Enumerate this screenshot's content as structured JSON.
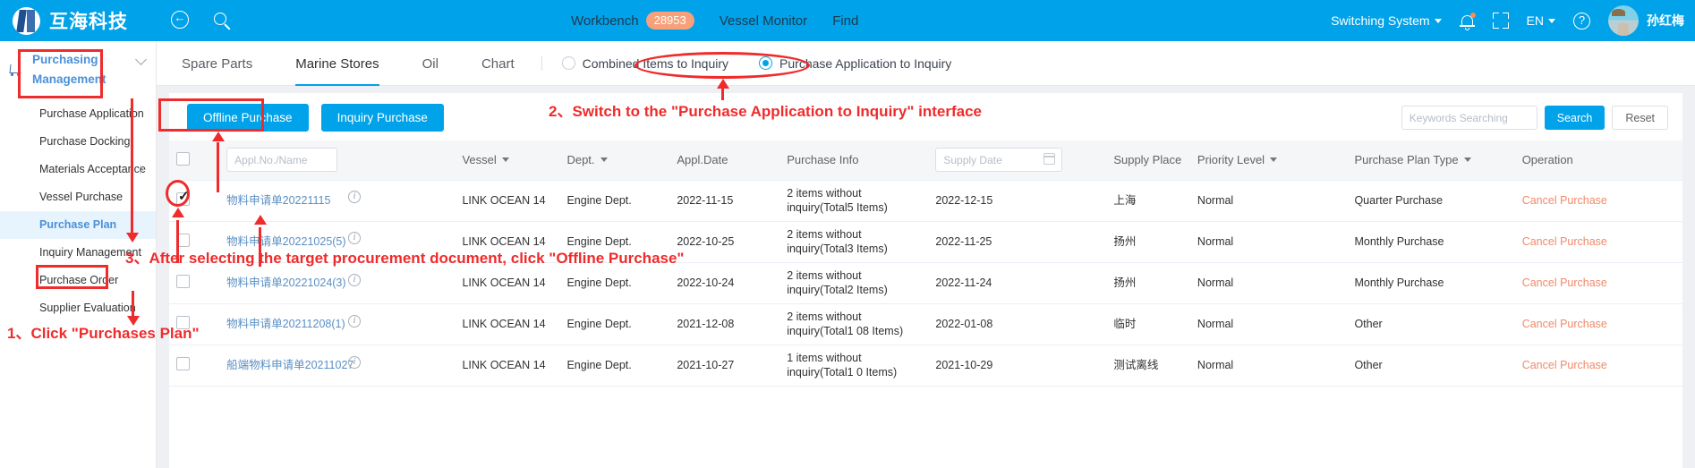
{
  "header": {
    "brand": "互海科技",
    "back_icon": "back-circle-icon",
    "search_icon": "search-icon",
    "workbench_label": "Workbench",
    "workbench_count": "28953",
    "vessel_monitor_label": "Vessel Monitor",
    "find_label": "Find",
    "switching_system_label": "Switching System",
    "bell_icon": "notification-bell-icon",
    "fullscreen_icon": "fullscreen-icon",
    "language_label": "EN",
    "help_icon": "help-circle-icon",
    "user_name": "孙红梅"
  },
  "sidebar": {
    "section_title": "Purchasing Management",
    "items": [
      {
        "label": "Purchase Application",
        "active": false,
        "has_sub": false
      },
      {
        "label": "Purchase Docking",
        "active": false,
        "has_sub": false
      },
      {
        "label": "Materials Acceptance",
        "active": false,
        "has_sub": true
      },
      {
        "label": "Vessel Purchase",
        "active": false,
        "has_sub": false
      },
      {
        "label": "Purchase Plan",
        "active": true,
        "has_sub": false
      },
      {
        "label": "Inquiry Management",
        "active": false,
        "has_sub": false
      },
      {
        "label": "Purchase Order",
        "active": false,
        "has_sub": false
      },
      {
        "label": "Supplier Evaluation",
        "active": false,
        "has_sub": false
      }
    ]
  },
  "tabs": [
    {
      "label": "Spare Parts",
      "active": false
    },
    {
      "label": "Marine Stores",
      "active": true
    },
    {
      "label": "Oil",
      "active": false
    },
    {
      "label": "Chart",
      "active": false
    }
  ],
  "radios": [
    {
      "label": "Combined Items to Inquiry",
      "checked": false
    },
    {
      "label": "Purchase Application to Inquiry",
      "checked": true
    }
  ],
  "toolbar": {
    "offline_purchase_label": "Offline Purchase",
    "inquiry_purchase_label": "Inquiry Purchase",
    "keywords_placeholder": "Keywords Searching",
    "keywords_value": "",
    "search_label": "Search",
    "reset_label": "Reset"
  },
  "table": {
    "columns": [
      {
        "key": "checkbox",
        "label": ""
      },
      {
        "key": "appl_no",
        "label": "Appl.No./Name",
        "type": "input",
        "placeholder": "Appl.No./Name"
      },
      {
        "key": "vessel",
        "label": "Vessel",
        "sortable": true
      },
      {
        "key": "dept",
        "label": "Dept.",
        "sortable": true
      },
      {
        "key": "appl_date",
        "label": "Appl.Date"
      },
      {
        "key": "purchase_info",
        "label": "Purchase Info"
      },
      {
        "key": "supply_date",
        "label": "Supply Date",
        "type": "date",
        "placeholder": "Supply Date"
      },
      {
        "key": "supply_place",
        "label": "Supply Place"
      },
      {
        "key": "priority",
        "label": "Priority Level",
        "sortable": true
      },
      {
        "key": "plan_type",
        "label": "Purchase Plan Type",
        "sortable": true
      },
      {
        "key": "operation",
        "label": "Operation"
      }
    ],
    "header_all_checked": false,
    "rows": [
      {
        "checked": true,
        "appl_no": "物料申请单20221115",
        "info_icon": "info-circle-icon",
        "vessel": "LINK OCEAN 14",
        "dept": "Engine Dept.",
        "appl_date": "2022-11-15",
        "purchase_info": "2 items without inquiry(Total5 Items)",
        "supply_date": "2022-12-15",
        "supply_place": "上海",
        "priority": "Normal",
        "plan_type": "Quarter Purchase",
        "operation": "Cancel Purchase"
      },
      {
        "checked": false,
        "appl_no": "物料申请单20221025(5)",
        "info_icon": "info-circle-icon",
        "vessel": "LINK OCEAN 14",
        "dept": "Engine Dept.",
        "appl_date": "2022-10-25",
        "purchase_info": "2 items without inquiry(Total3 Items)",
        "supply_date": "2022-11-25",
        "supply_place": "扬州",
        "priority": "Normal",
        "plan_type": "Monthly Purchase",
        "operation": "Cancel Purchase"
      },
      {
        "checked": false,
        "appl_no": "物料申请单20221024(3)",
        "info_icon": "info-circle-icon",
        "vessel": "LINK OCEAN 14",
        "dept": "Engine Dept.",
        "appl_date": "2022-10-24",
        "purchase_info": "2 items without inquiry(Total2 Items)",
        "supply_date": "2022-11-24",
        "supply_place": "扬州",
        "priority": "Normal",
        "plan_type": "Monthly Purchase",
        "operation": "Cancel Purchase"
      },
      {
        "checked": false,
        "appl_no": "物料申请单20211208(1)",
        "info_icon": "info-circle-icon",
        "vessel": "LINK OCEAN 14",
        "dept": "Engine Dept.",
        "appl_date": "2021-12-08",
        "purchase_info": "2 items without inquiry(Total1 08 Items)",
        "supply_date": "2022-01-08",
        "supply_place": "临时",
        "priority": "Normal",
        "plan_type": "Other",
        "operation": "Cancel Purchase"
      },
      {
        "checked": false,
        "appl_no": "船端物料申请单20211027",
        "info_icon": "info-circle-icon",
        "vessel": "LINK OCEAN 14",
        "dept": "Engine Dept.",
        "appl_date": "2021-10-27",
        "purchase_info": "1 items without inquiry(Total1 0 Items)",
        "supply_date": "2021-10-29",
        "supply_place": "测试离线",
        "priority": "Normal",
        "plan_type": "Other",
        "operation": "Cancel Purchase"
      }
    ]
  },
  "annotations": {
    "step1": "1、Click \"Purchases Plan\"",
    "step2": "2、Switch to the \"Purchase Application to Inquiry\" interface",
    "step3": "3、After selecting the target procurement document, click \"Offline Purchase\"",
    "color": "#ef2b2b"
  }
}
